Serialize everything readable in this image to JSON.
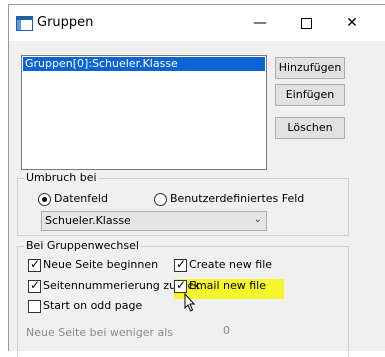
{
  "window": {
    "title": "Gruppen",
    "controls": {
      "minimize": "—",
      "maximize": "",
      "close": "✕"
    }
  },
  "groups_list": {
    "items": [
      "Gruppen[0]:Schueler.Klasse"
    ]
  },
  "buttons": {
    "add": "Hinzufügen",
    "insert": "Einfügen",
    "delete": "Löschen"
  },
  "umbruch": {
    "label": "Umbruch bei",
    "radio_datafield": "Datenfeld",
    "radio_custom": "Benutzerdefiniertes Feld",
    "selected": "datafield",
    "field_value": "Schueler.Klasse"
  },
  "wechsel": {
    "label": "Bei Gruppenwechsel",
    "new_page": {
      "label": "Neue Seite beginnen",
      "checked": true
    },
    "create_file": {
      "label": "Create new file",
      "checked": true
    },
    "reset_numbering": {
      "label": "Seitennummerierung zurück",
      "checked": true
    },
    "email_file": {
      "label": "Email new file",
      "checked": true
    },
    "odd_page": {
      "label": "Start on odd page",
      "checked": false
    },
    "new_page_below_label": "Neue Seite bei weniger als",
    "new_page_below_value": "0"
  },
  "colors": {
    "selection": "#0a64d2",
    "highlight": "#f6f62c"
  }
}
